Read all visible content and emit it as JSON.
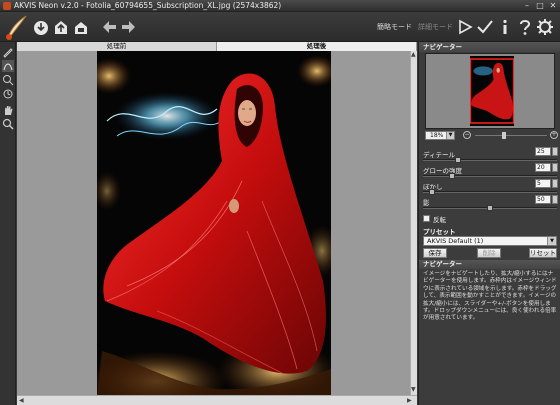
{
  "window": {
    "title": "AKVIS Neon v.2.0 - Fotolia_60794655_Subscription_XL.jpg (2574x3862)",
    "minimize": "–",
    "maximize": "□",
    "close": "✕"
  },
  "toolbar": {
    "modes": {
      "express": "簡略モード",
      "advanced": "詳細モード"
    },
    "icons": [
      "logo-icon",
      "open-icon",
      "save-icon",
      "print-icon",
      "undo-icon",
      "redo-icon",
      "run-icon",
      "apply-icon",
      "info-icon",
      "help-icon",
      "settings-icon"
    ]
  },
  "canvas": {
    "tabs": {
      "before": "処理前",
      "after": "処理後"
    },
    "active_tab": "after"
  },
  "navigator": {
    "title": "ナビゲーター",
    "zoom": "18%",
    "zoom_level": 0.4
  },
  "params": [
    {
      "label": "ディテール",
      "value": "25",
      "level": 0.25
    },
    {
      "label": "グローの強度",
      "value": "20",
      "level": 0.2
    },
    {
      "label": "ぼかし",
      "value": "5",
      "level": 0.05
    },
    {
      "label": "影",
      "value": "50",
      "level": 0.5
    }
  ],
  "invert": {
    "label": "反転",
    "checked": false
  },
  "presets": {
    "title": "プリセット",
    "selected": "AKVIS Default (1)",
    "save": "保存",
    "delete": "削除",
    "reset": "リセット"
  },
  "hint": {
    "title": "ナビゲーター",
    "text": "イメージをナビゲートしたり、拡大/縮小するにはナビゲーターを使用します。赤枠内はイメージウィンドウに表示されている領域を示します。赤枠をドラッグして、表示範囲を動かすことができます。イメージの拡大/縮小には、スライダーや+/-ボタンを使用します。ドロップダウンメニューには、良く使われる倍率が用意されています。"
  },
  "colors": {
    "accent_red": "#c81414",
    "panel_bg": "#3c3c3c",
    "canvas_bg": "#9a9a9a"
  }
}
